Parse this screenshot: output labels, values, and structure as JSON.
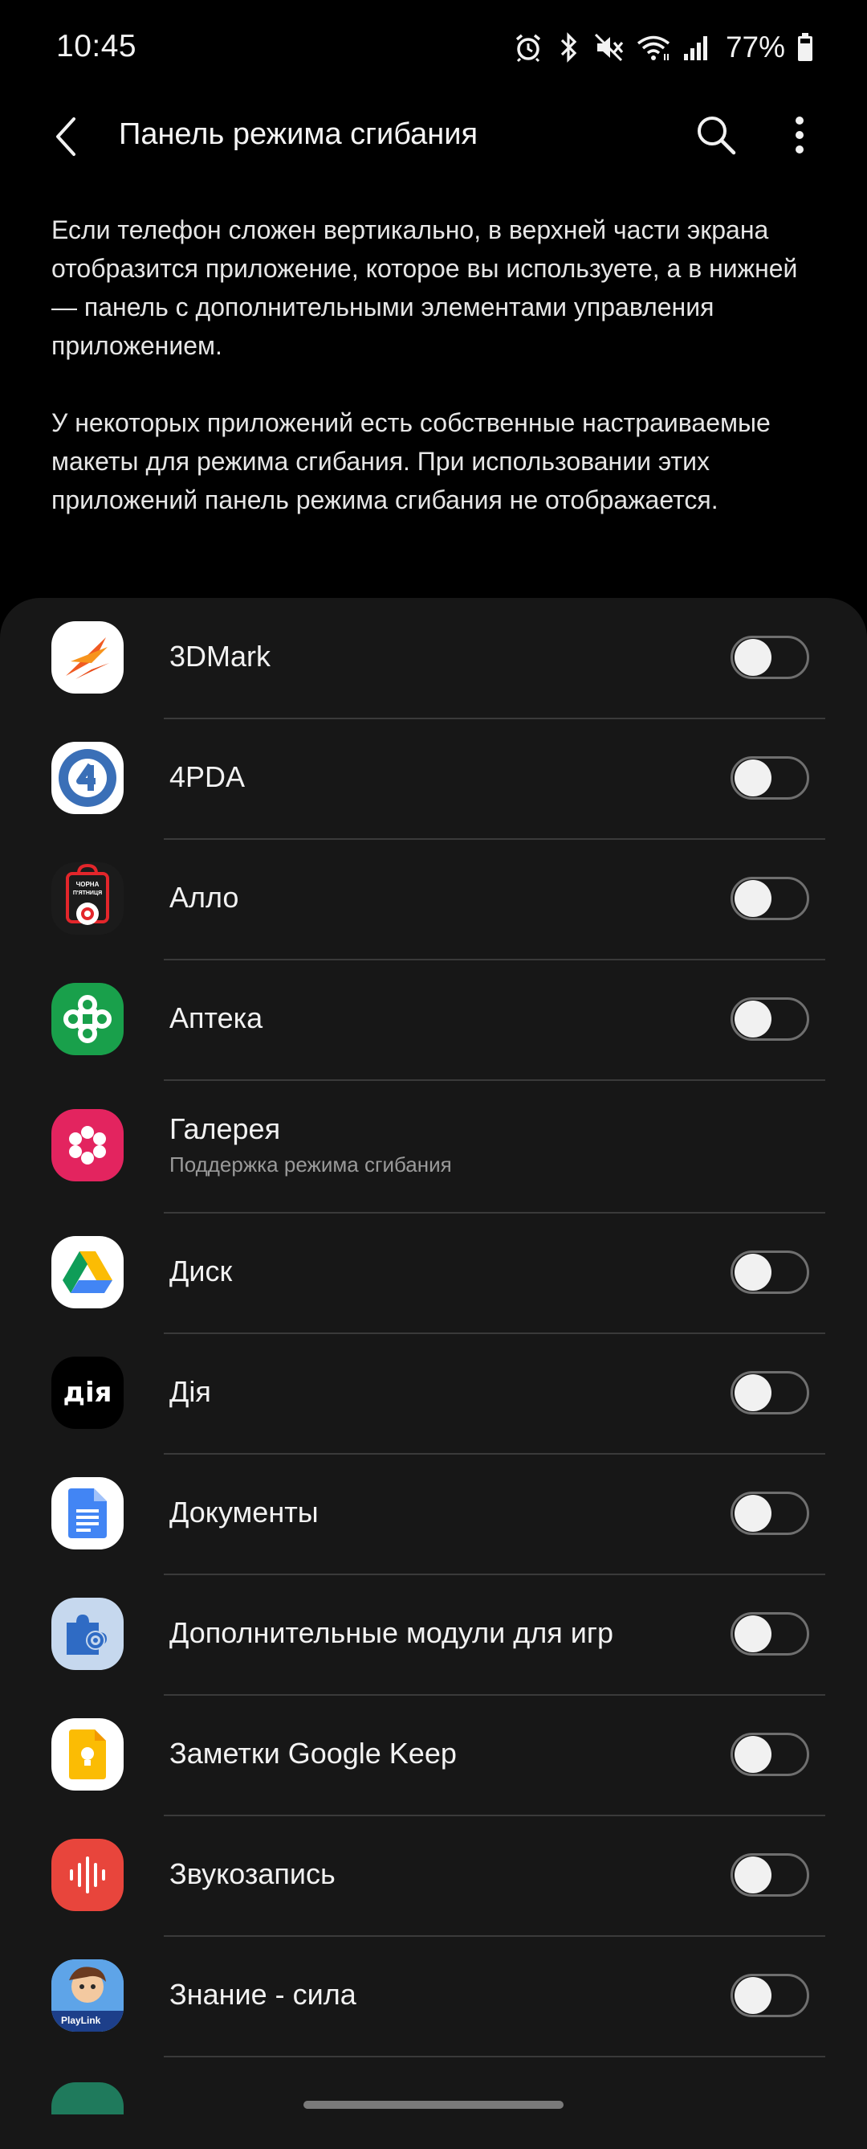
{
  "status_bar": {
    "time": "10:45",
    "battery": "77%",
    "icons": [
      "alarm-icon",
      "bluetooth-icon",
      "mute-icon",
      "wifi-icon",
      "signal-icon",
      "battery-icon"
    ]
  },
  "app_bar": {
    "title": "Панель режима сгибания",
    "icons": [
      "back-arrow-icon",
      "search-icon",
      "more-vert-icon"
    ]
  },
  "description": {
    "paragraph1": "Если телефон сложен вертикально, в верхней части экрана отобразится приложение, которое вы используете, а в нижней — панель с дополнительными элементами управления приложением.",
    "paragraph2": "У некоторых приложений есть собственные настраиваемые макеты для режима сгибания. При использовании этих приложений панель режима сгибания не отображается."
  },
  "apps": [
    {
      "name": "3DMark",
      "icon": "3dmark-icon",
      "toggle": false
    },
    {
      "name": "4PDA",
      "icon": "4pda-icon",
      "toggle": false
    },
    {
      "name": "Алло",
      "icon": "allo-icon",
      "icon_text": "ЧОРНА П'ЯТНИЦЯ",
      "toggle": false
    },
    {
      "name": "Аптека",
      "icon": "apteka-icon",
      "toggle": false
    },
    {
      "name": "Галерея",
      "icon": "gallery-icon",
      "subtitle": "Поддержка режима сгибания"
    },
    {
      "name": "Диск",
      "icon": "drive-icon",
      "toggle": false
    },
    {
      "name": "Дія",
      "icon": "diia-icon",
      "icon_text": "дія",
      "toggle": false
    },
    {
      "name": "Документы",
      "icon": "docs-icon",
      "toggle": false
    },
    {
      "name": "Дополнительные модули для игр",
      "icon": "game-plugins-icon",
      "toggle": false
    },
    {
      "name": "Заметки Google Keep",
      "icon": "keep-icon",
      "toggle": false
    },
    {
      "name": "Звукозапись",
      "icon": "voice-recorder-icon",
      "toggle": false
    },
    {
      "name": "Знание - сила",
      "icon": "knowledge-is-power-icon",
      "icon_text": "PlayLink",
      "toggle": false
    }
  ]
}
